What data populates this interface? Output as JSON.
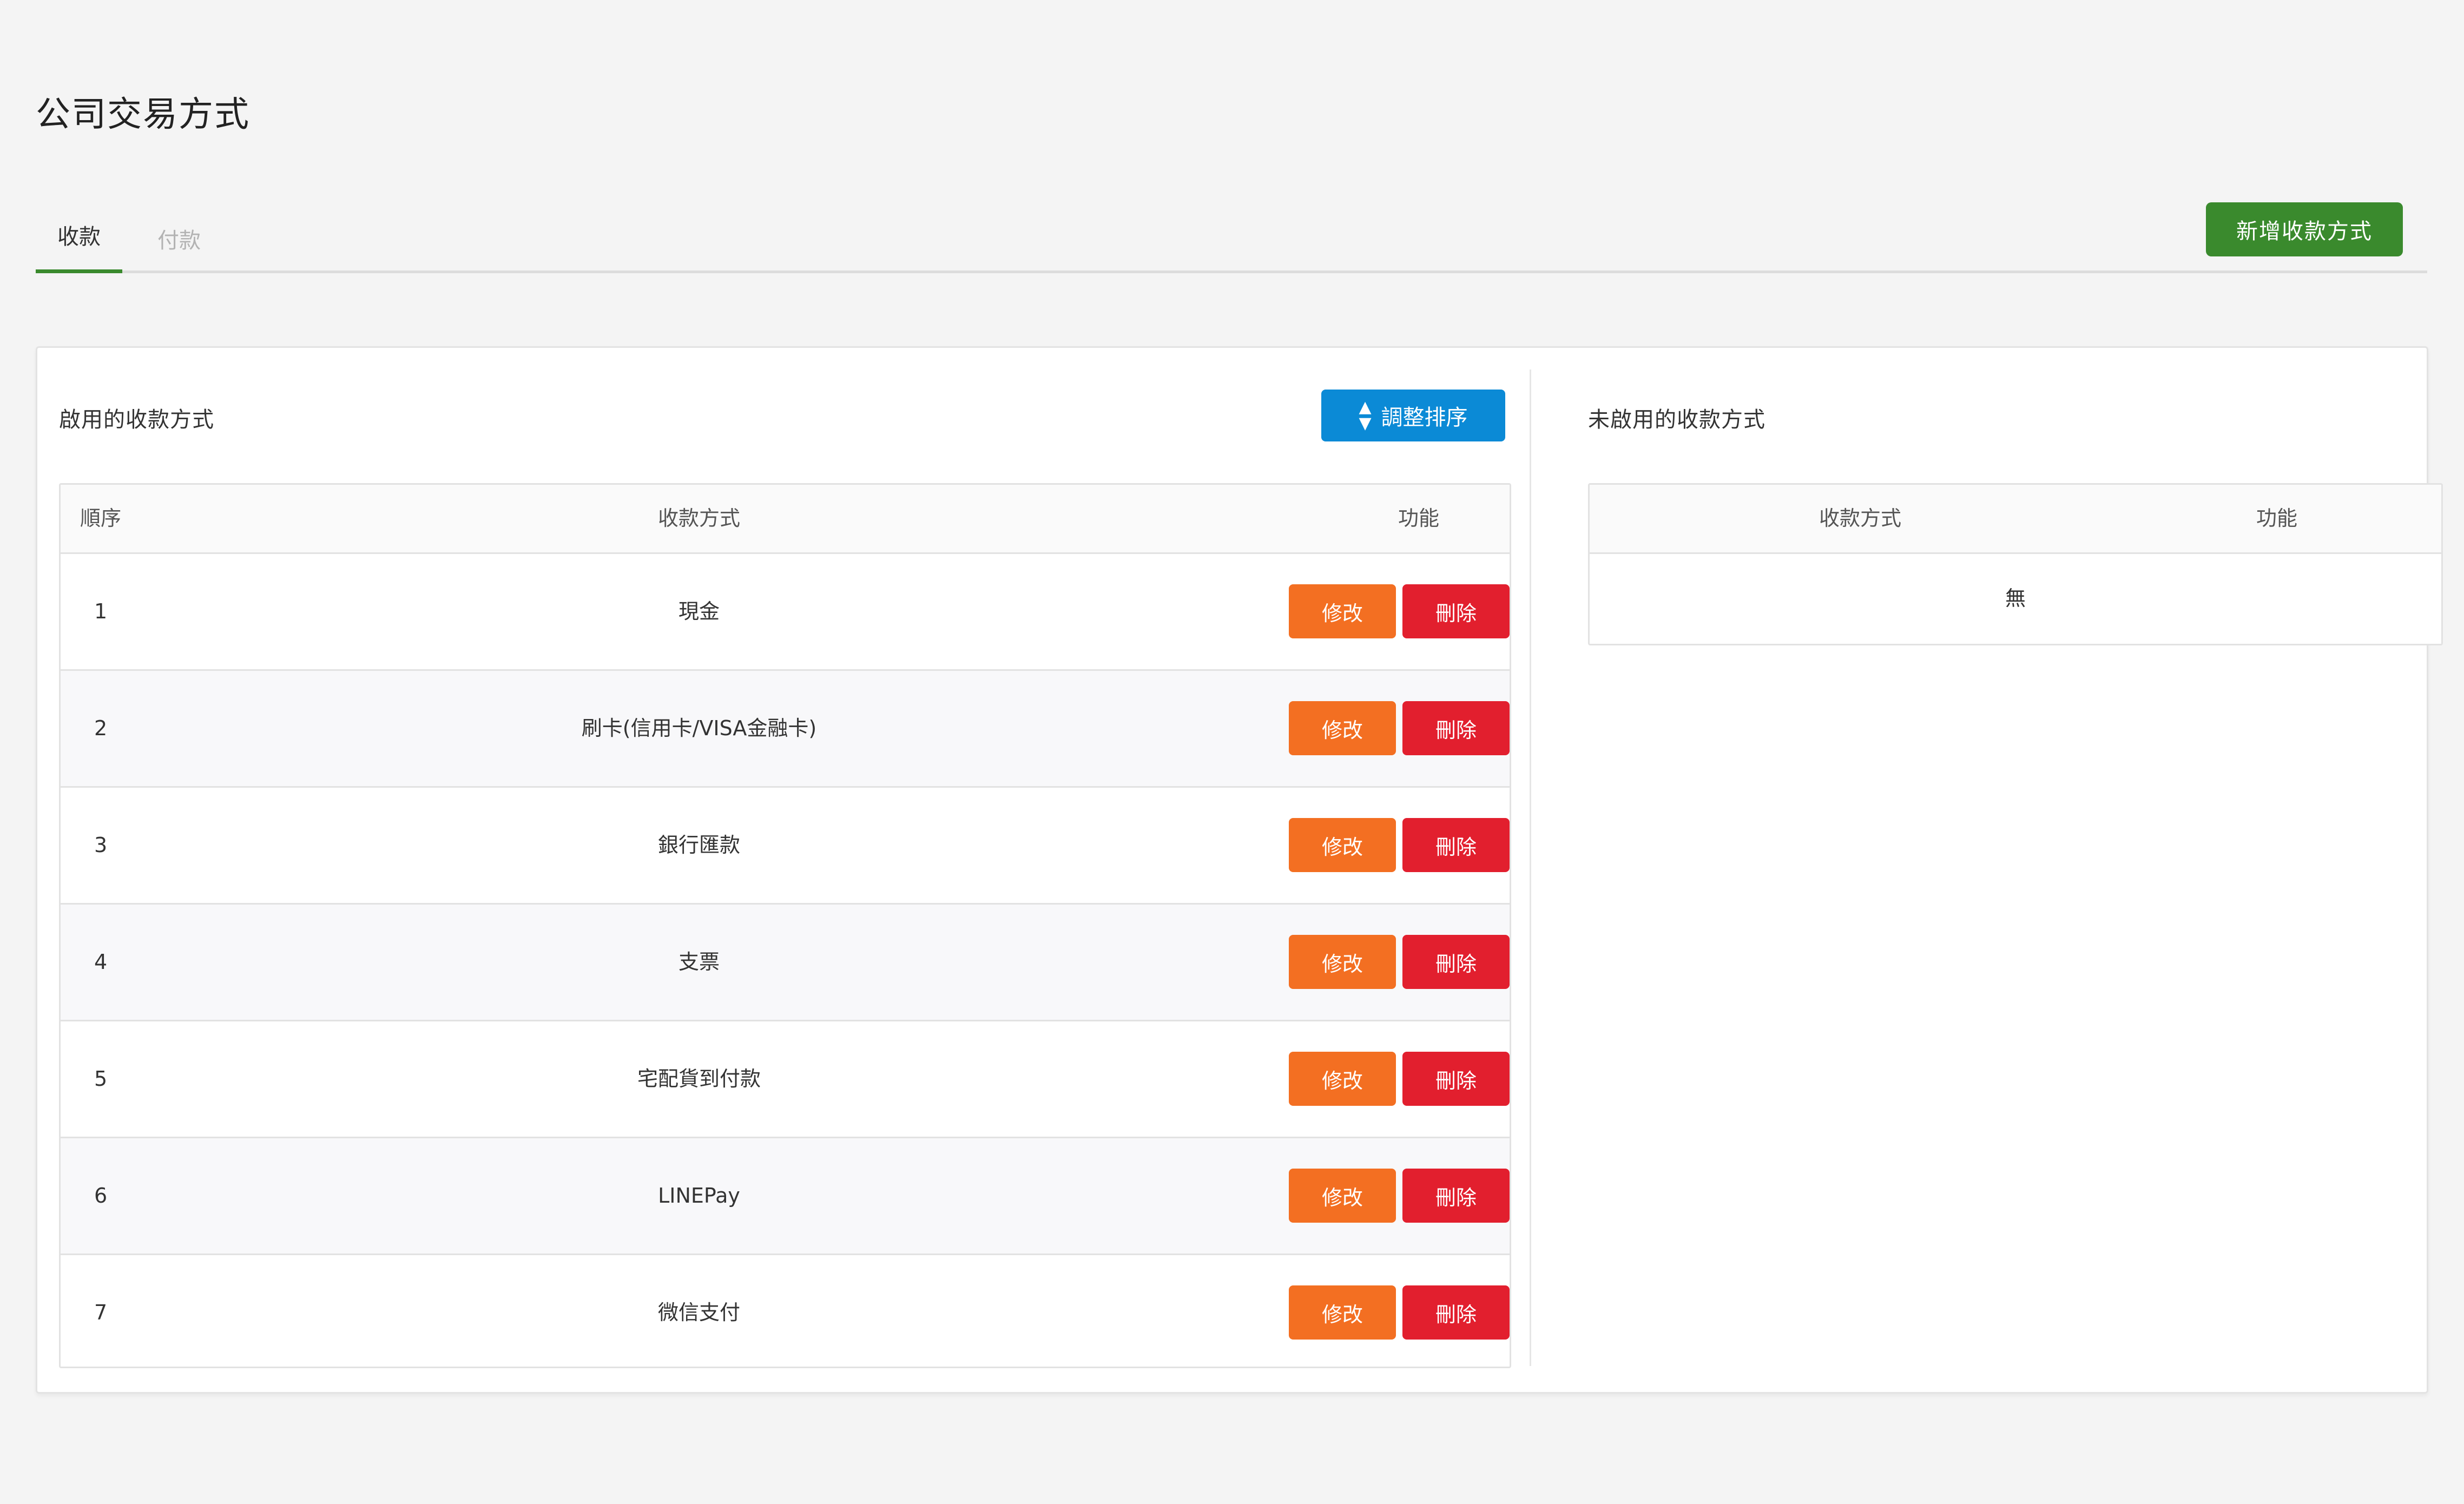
{
  "page": {
    "title": "公司交易方式"
  },
  "tabs": [
    {
      "label": "收款",
      "active": true
    },
    {
      "label": "付款",
      "active": false
    }
  ],
  "add_button": {
    "label": "新增收款方式",
    "color": "#3a8a2d"
  },
  "enabled": {
    "title": "啟用的收款方式",
    "sort_button": {
      "label": "調整排序",
      "icon": "sort-icon",
      "color": "#0b8ad6"
    },
    "columns": [
      "順序",
      "收款方式",
      "功能"
    ],
    "rows": [
      {
        "order": "1",
        "method": "現金"
      },
      {
        "order": "2",
        "method": "刷卡(信用卡/VISA金融卡)"
      },
      {
        "order": "3",
        "method": "銀行匯款"
      },
      {
        "order": "4",
        "method": "支票"
      },
      {
        "order": "5",
        "method": "宅配貨到付款"
      },
      {
        "order": "6",
        "method": "LINEPay"
      },
      {
        "order": "7",
        "method": "微信支付"
      }
    ],
    "edit_label": "修改",
    "delete_label": "刪除",
    "edit_color": "#f36f22",
    "delete_color": "#e21f2e"
  },
  "disabled": {
    "title": "未啟用的收款方式",
    "columns": [
      "收款方式",
      "功能"
    ],
    "empty_text": "無"
  }
}
